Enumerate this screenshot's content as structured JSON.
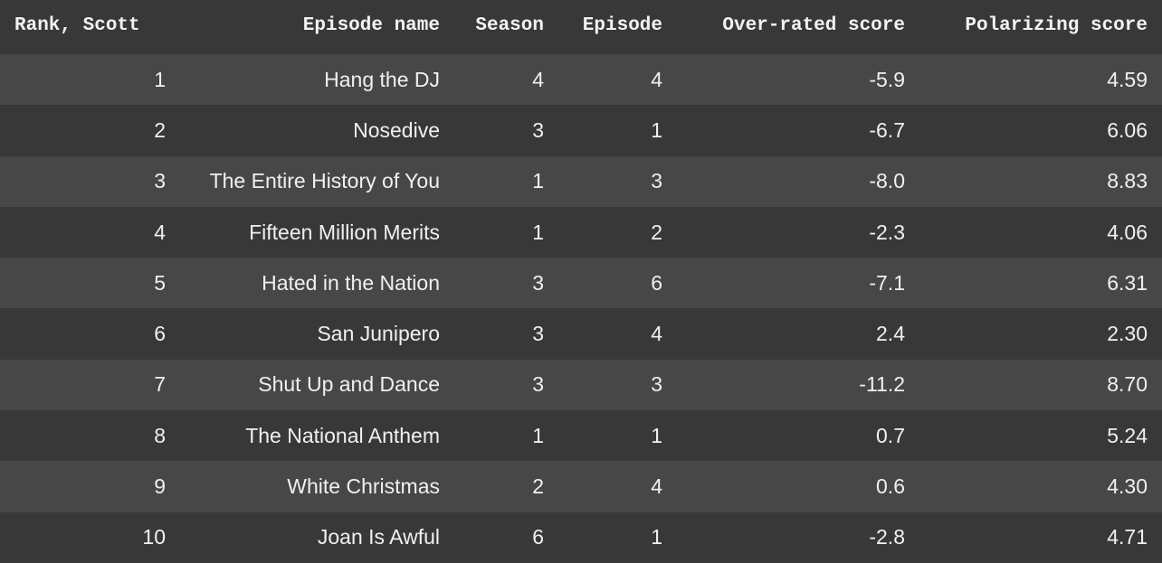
{
  "table": {
    "columns": [
      "Rank, Scott",
      "Episode name",
      "Season",
      "Episode",
      "Over-rated score",
      "Polarizing score"
    ],
    "rows": [
      [
        "1",
        "Hang the DJ",
        "4",
        "4",
        "-5.9",
        "4.59"
      ],
      [
        "2",
        "Nosedive",
        "3",
        "1",
        "-6.7",
        "6.06"
      ],
      [
        "3",
        "The Entire History of You",
        "1",
        "3",
        "-8.0",
        "8.83"
      ],
      [
        "4",
        "Fifteen Million Merits",
        "1",
        "2",
        "-2.3",
        "4.06"
      ],
      [
        "5",
        "Hated in the Nation",
        "3",
        "6",
        "-7.1",
        "6.31"
      ],
      [
        "6",
        "San Junipero",
        "3",
        "4",
        "2.4",
        "2.30"
      ],
      [
        "7",
        "Shut Up and Dance",
        "3",
        "3",
        "-11.2",
        "8.70"
      ],
      [
        "8",
        "The National Anthem",
        "1",
        "1",
        "0.7",
        "5.24"
      ],
      [
        "9",
        "White Christmas",
        "2",
        "4",
        "0.6",
        "4.30"
      ],
      [
        "10",
        "Joan Is Awful",
        "6",
        "1",
        "-2.8",
        "4.71"
      ]
    ]
  },
  "colors": {
    "background": "#383838",
    "row_stripe": "#474747",
    "text": "#f0f0f0"
  }
}
